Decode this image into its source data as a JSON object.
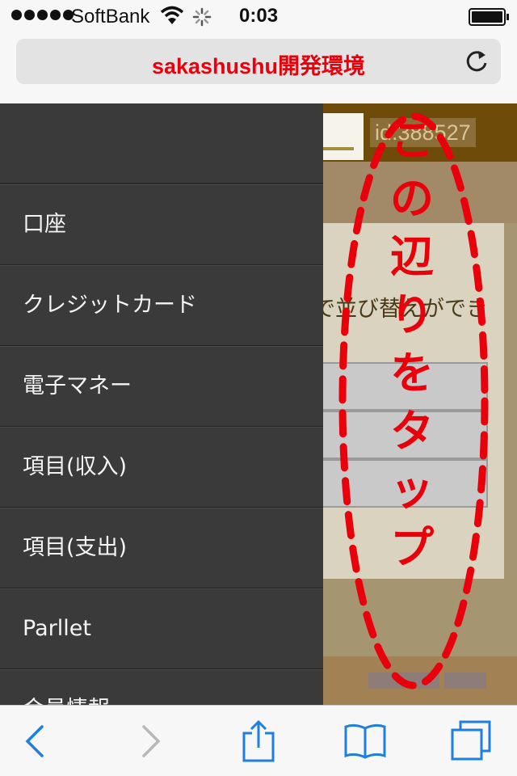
{
  "status_bar": {
    "carrier": "SoftBank",
    "time": "0:03",
    "signal_icon": "signal-dots-icon",
    "wifi_icon": "wifi-icon",
    "loading_icon": "activity-spinner-icon",
    "battery_level": 1.0
  },
  "url_bar": {
    "title": "sakashushu開発環境",
    "reload_icon": "reload-icon"
  },
  "drawer": {
    "items": [
      {
        "label": "口座"
      },
      {
        "label": "クレジットカード"
      },
      {
        "label": "電子マネー"
      },
      {
        "label": "項目(収入)"
      },
      {
        "label": "項目(支出)"
      },
      {
        "label": "Parllet"
      },
      {
        "label": "会員情報"
      }
    ]
  },
  "page": {
    "user_id": "id:388527",
    "content_text": "で並び替えができ"
  },
  "annotation": {
    "chars": [
      "こ",
      "の",
      "辺",
      "り",
      "を",
      "タ",
      "ッ",
      "プ"
    ]
  },
  "toolbar": {
    "back_icon": "back-arrow-icon",
    "forward_icon": "forward-arrow-icon",
    "share_icon": "share-icon",
    "bookmarks_icon": "bookmarks-icon",
    "tabs_icon": "tabs-icon"
  },
  "colors": {
    "accent_red": "#e8000b",
    "drawer_bg": "#3a3a3a",
    "ios_blue": "#1e7fdc"
  }
}
